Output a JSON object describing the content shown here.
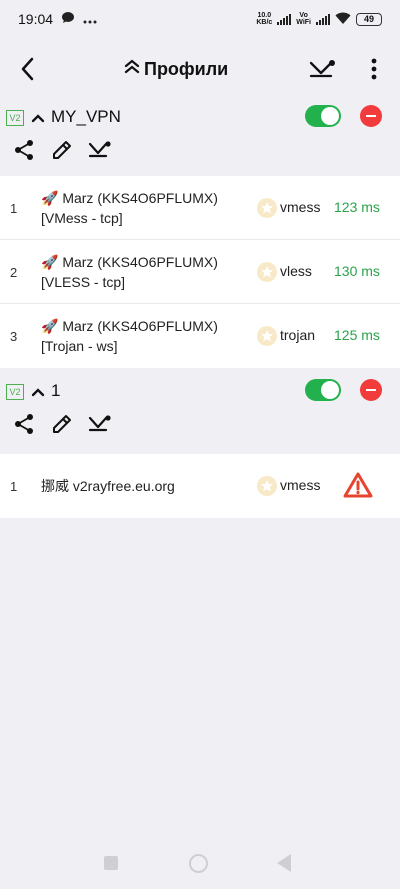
{
  "status_bar": {
    "time": "19:04",
    "net_speed_value": "10.0",
    "net_speed_unit": "KB/c",
    "vowifi_top": "Vo",
    "vowifi_bottom": "WiFi",
    "battery": "49",
    "icons": [
      "chat-bubble-icon",
      "more-dots-icon",
      "signal-icon",
      "signal-icon",
      "wifi-icon",
      "battery-icon"
    ]
  },
  "toolbar": {
    "title": "Профили",
    "icons": [
      "back-arrow-icon",
      "double-chevron-up-icon",
      "test-speed-icon",
      "more-vert-icon"
    ]
  },
  "groups": [
    {
      "badge": "V2",
      "name": "MY_VPN",
      "enabled": true,
      "actions": [
        "share-icon",
        "edit-icon",
        "test-speed-icon"
      ],
      "servers": [
        {
          "num": "1",
          "line1": "🚀 Marz (KKS4O6PFLUMX)",
          "line2": "[VMess - tcp]",
          "protocol": "vmess",
          "latency": "123 ms"
        },
        {
          "num": "2",
          "line1": "🚀 Marz (KKS4O6PFLUMX)",
          "line2": "[VLESS - tcp]",
          "protocol": "vless",
          "latency": "130 ms"
        },
        {
          "num": "3",
          "line1": "🚀 Marz (KKS4O6PFLUMX)",
          "line2": "[Trojan - ws]",
          "protocol": "trojan",
          "latency": "125 ms"
        }
      ]
    },
    {
      "badge": "V2",
      "name": "1",
      "enabled": true,
      "actions": [
        "share-icon",
        "edit-icon",
        "test-speed-icon"
      ],
      "servers": [
        {
          "num": "1",
          "line1": "挪威 v2rayfree.eu.org",
          "line2": "",
          "protocol": "vmess",
          "status_icon": "warning-icon"
        }
      ]
    }
  ],
  "colors": {
    "background": "#f0eff4",
    "accent_green": "#22b14c",
    "latency_green": "#2aa34a",
    "remove_red": "#f23c3c",
    "warning_red": "#e8432e",
    "star_bg": "#f8e9c8"
  }
}
